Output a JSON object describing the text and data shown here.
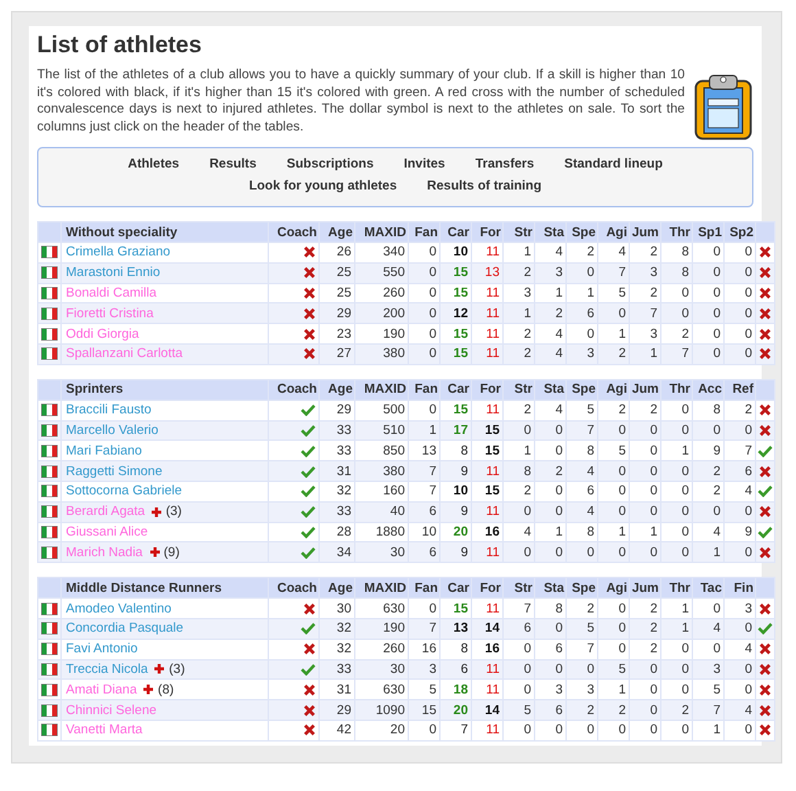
{
  "title": "List of athletes",
  "intro": "The list of the athletes of a club allows you to have a quickly summary of your club. If a skill is higher than 10 it's colored with black, if it's higher than 15 it's colored with green. A red cross with the number of scheduled convalescence days is next to injured athletes. The dollar symbol is next to the athletes on sale. To sort the columns just click on the header of the tables.",
  "nav": [
    [
      "Athletes",
      "Results",
      "Subscriptions",
      "Invites",
      "Transfers",
      "Standard lineup"
    ],
    [
      "Look for young athletes",
      "Results of training"
    ]
  ],
  "tables": [
    {
      "columns": [
        "Without speciality",
        "Coach",
        "Age",
        "MAXID",
        "Fan",
        "Car",
        "For",
        "Str",
        "Sta",
        "Spe",
        "Agi",
        "Jum",
        "Thr",
        "Sp1",
        "Sp2"
      ],
      "rows": [
        {
          "name": "Crimella Graziano",
          "color": "#3399cc",
          "coach": false,
          "age": "26",
          "maxid": "340",
          "fan": "0",
          "car": {
            "value": "10",
            "kind": "strong"
          },
          "for": {
            "value": "11",
            "kind": "warn"
          },
          "skills": [
            "1",
            "4",
            "2",
            "4",
            "2",
            "8",
            "0",
            "0"
          ],
          "ok": false
        },
        {
          "name": "Marastoni Ennio",
          "color": "#3399cc",
          "coach": false,
          "age": "25",
          "maxid": "550",
          "fan": "0",
          "car": {
            "value": "15",
            "kind": "high"
          },
          "for": {
            "value": "13",
            "kind": "warn"
          },
          "skills": [
            "2",
            "3",
            "0",
            "7",
            "3",
            "8",
            "0",
            "0"
          ],
          "ok": false
        },
        {
          "name": "Bonaldi Camilla",
          "color": "#ff66dd",
          "coach": false,
          "age": "25",
          "maxid": "260",
          "fan": "0",
          "car": {
            "value": "15",
            "kind": "high"
          },
          "for": {
            "value": "11",
            "kind": "warn"
          },
          "skills": [
            "3",
            "1",
            "1",
            "5",
            "2",
            "0",
            "0",
            "0"
          ],
          "ok": false
        },
        {
          "name": "Fioretti Cristina",
          "color": "#ff66dd",
          "coach": false,
          "age": "29",
          "maxid": "200",
          "fan": "0",
          "car": {
            "value": "12",
            "kind": "strong"
          },
          "for": {
            "value": "11",
            "kind": "warn"
          },
          "skills": [
            "1",
            "2",
            "6",
            "0",
            "7",
            "0",
            "0",
            "0"
          ],
          "ok": false
        },
        {
          "name": "Oddi Giorgia",
          "color": "#ff66dd",
          "coach": false,
          "age": "23",
          "maxid": "190",
          "fan": "0",
          "car": {
            "value": "15",
            "kind": "high"
          },
          "for": {
            "value": "11",
            "kind": "warn"
          },
          "skills": [
            "2",
            "4",
            "0",
            "1",
            "3",
            "2",
            "0",
            "0"
          ],
          "ok": false
        },
        {
          "name": "Spallanzani Carlotta",
          "color": "#ff66dd",
          "coach": false,
          "age": "27",
          "maxid": "380",
          "fan": "0",
          "car": {
            "value": "15",
            "kind": "high"
          },
          "for": {
            "value": "11",
            "kind": "warn"
          },
          "skills": [
            "2",
            "4",
            "3",
            "2",
            "1",
            "7",
            "0",
            "0"
          ],
          "ok": false
        }
      ]
    },
    {
      "columns": [
        "Sprinters",
        "Coach",
        "Age",
        "MAXID",
        "Fan",
        "Car",
        "For",
        "Str",
        "Sta",
        "Spe",
        "Agi",
        "Jum",
        "Thr",
        "Acc",
        "Ref"
      ],
      "rows": [
        {
          "name": "Braccili Fausto",
          "color": "#3399cc",
          "coach": true,
          "age": "29",
          "maxid": "500",
          "fan": "0",
          "car": {
            "value": "15",
            "kind": "high"
          },
          "for": {
            "value": "11",
            "kind": "warn"
          },
          "skills": [
            "2",
            "4",
            "5",
            "2",
            "2",
            "0",
            "8",
            "2"
          ],
          "ok": false
        },
        {
          "name": "Marcello Valerio",
          "color": "#3399cc",
          "coach": true,
          "age": "33",
          "maxid": "510",
          "fan": "1",
          "car": {
            "value": "17",
            "kind": "high"
          },
          "for": {
            "value": "15",
            "kind": "strong"
          },
          "skills": [
            "0",
            "0",
            "7",
            "0",
            "0",
            "0",
            "0",
            "0"
          ],
          "ok": false
        },
        {
          "name": "Mari Fabiano",
          "color": "#3399cc",
          "coach": true,
          "age": "33",
          "maxid": "850",
          "fan": "13",
          "car": {
            "value": "8",
            "kind": "normal"
          },
          "for": {
            "value": "15",
            "kind": "strong"
          },
          "skills": [
            "1",
            "0",
            "8",
            "5",
            "0",
            "1",
            "9",
            "7"
          ],
          "ok": true
        },
        {
          "name": "Raggetti Simone",
          "color": "#3399cc",
          "coach": true,
          "age": "31",
          "maxid": "380",
          "fan": "7",
          "car": {
            "value": "9",
            "kind": "normal"
          },
          "for": {
            "value": "11",
            "kind": "warn"
          },
          "skills": [
            "8",
            "2",
            "4",
            "0",
            "0",
            "0",
            "2",
            "6"
          ],
          "ok": false
        },
        {
          "name": "Sottocorna Gabriele",
          "color": "#3399cc",
          "coach": true,
          "age": "32",
          "maxid": "160",
          "fan": "7",
          "car": {
            "value": "10",
            "kind": "strong"
          },
          "for": {
            "value": "15",
            "kind": "strong"
          },
          "skills": [
            "2",
            "0",
            "6",
            "0",
            "0",
            "0",
            "2",
            "4"
          ],
          "ok": true
        },
        {
          "name": "Berardi Agata",
          "color": "#ff66dd",
          "injury": "(3)",
          "coach": true,
          "age": "33",
          "maxid": "40",
          "fan": "6",
          "car": {
            "value": "9",
            "kind": "normal"
          },
          "for": {
            "value": "11",
            "kind": "warn"
          },
          "skills": [
            "0",
            "0",
            "4",
            "0",
            "0",
            "0",
            "0",
            "0"
          ],
          "ok": false
        },
        {
          "name": "Giussani Alice",
          "color": "#ff66dd",
          "coach": true,
          "age": "28",
          "maxid": "1880",
          "fan": "10",
          "car": {
            "value": "20",
            "kind": "high"
          },
          "for": {
            "value": "16",
            "kind": "strong"
          },
          "skills": [
            "4",
            "1",
            "8",
            "1",
            "1",
            "0",
            "4",
            "9"
          ],
          "ok": true
        },
        {
          "name": "Marich Nadia",
          "color": "#ff66dd",
          "injury": "(9)",
          "coach": true,
          "age": "34",
          "maxid": "30",
          "fan": "6",
          "car": {
            "value": "9",
            "kind": "normal"
          },
          "for": {
            "value": "11",
            "kind": "warn"
          },
          "skills": [
            "0",
            "0",
            "0",
            "0",
            "0",
            "0",
            "1",
            "0"
          ],
          "ok": false
        }
      ]
    },
    {
      "columns": [
        "Middle Distance Runners",
        "Coach",
        "Age",
        "MAXID",
        "Fan",
        "Car",
        "For",
        "Str",
        "Sta",
        "Spe",
        "Agi",
        "Jum",
        "Thr",
        "Tac",
        "Fin"
      ],
      "rows": [
        {
          "name": "Amodeo Valentino",
          "color": "#3399cc",
          "coach": false,
          "age": "30",
          "maxid": "630",
          "fan": "0",
          "car": {
            "value": "15",
            "kind": "high"
          },
          "for": {
            "value": "11",
            "kind": "warn"
          },
          "skills": [
            "7",
            "8",
            "2",
            "0",
            "2",
            "1",
            "0",
            "3"
          ],
          "ok": false
        },
        {
          "name": "Concordia Pasquale",
          "color": "#3399cc",
          "coach": true,
          "age": "32",
          "maxid": "190",
          "fan": "7",
          "car": {
            "value": "13",
            "kind": "strong"
          },
          "for": {
            "value": "14",
            "kind": "strong"
          },
          "skills": [
            "6",
            "0",
            "5",
            "0",
            "2",
            "1",
            "4",
            "0"
          ],
          "ok": true
        },
        {
          "name": "Favi Antonio",
          "color": "#3399cc",
          "coach": false,
          "age": "32",
          "maxid": "260",
          "fan": "16",
          "car": {
            "value": "8",
            "kind": "normal"
          },
          "for": {
            "value": "16",
            "kind": "strong"
          },
          "skills": [
            "0",
            "6",
            "7",
            "0",
            "2",
            "0",
            "0",
            "4"
          ],
          "ok": false
        },
        {
          "name": "Treccia Nicola",
          "color": "#3399cc",
          "injury": "(3)",
          "coach": true,
          "age": "33",
          "maxid": "30",
          "fan": "3",
          "car": {
            "value": "6",
            "kind": "normal"
          },
          "for": {
            "value": "11",
            "kind": "warn"
          },
          "skills": [
            "0",
            "0",
            "0",
            "5",
            "0",
            "0",
            "3",
            "0"
          ],
          "ok": false
        },
        {
          "name": "Amati Diana",
          "color": "#ff66dd",
          "injury": "(8)",
          "coach": false,
          "age": "31",
          "maxid": "630",
          "fan": "5",
          "car": {
            "value": "18",
            "kind": "high"
          },
          "for": {
            "value": "11",
            "kind": "warn"
          },
          "skills": [
            "0",
            "3",
            "3",
            "1",
            "0",
            "0",
            "5",
            "0"
          ],
          "ok": false
        },
        {
          "name": "Chinnici Selene",
          "color": "#ff66dd",
          "coach": false,
          "age": "29",
          "maxid": "1090",
          "fan": "15",
          "car": {
            "value": "20",
            "kind": "high"
          },
          "for": {
            "value": "14",
            "kind": "strong"
          },
          "skills": [
            "5",
            "6",
            "2",
            "2",
            "0",
            "2",
            "7",
            "4"
          ],
          "ok": false
        },
        {
          "name": "Vanetti Marta",
          "color": "#ff66dd",
          "coach": false,
          "age": "42",
          "maxid": "20",
          "fan": "0",
          "car": {
            "value": "7",
            "kind": "normal"
          },
          "for": {
            "value": "11",
            "kind": "warn"
          },
          "skills": [
            "0",
            "0",
            "0",
            "0",
            "0",
            "0",
            "1",
            "0"
          ],
          "ok": false
        }
      ]
    }
  ]
}
